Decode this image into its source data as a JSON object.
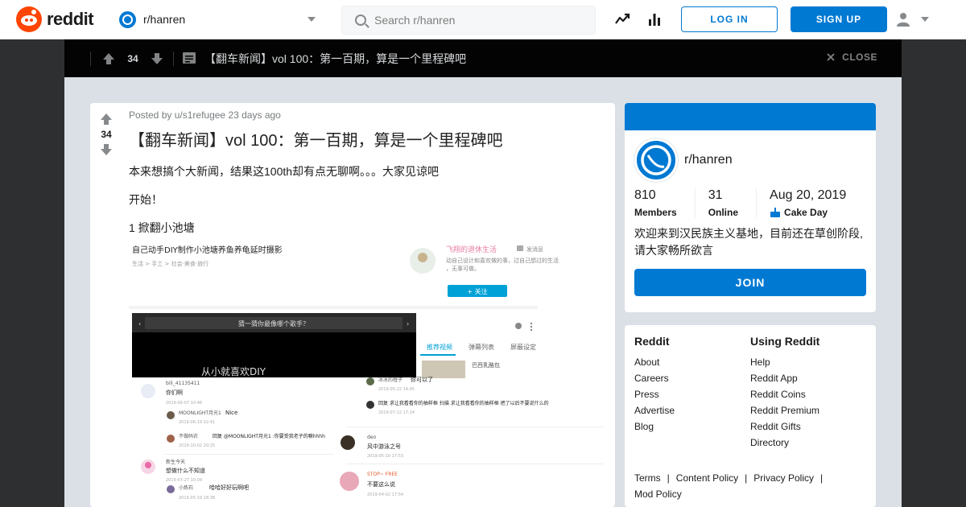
{
  "header": {
    "logo_text": "reddit",
    "community": "r/hanren",
    "search_placeholder": "Search r/hanren",
    "login_label": "LOG IN",
    "signup_label": "SIGN UP",
    "brand_color": "#ff4500",
    "accent_color": "#0079d3"
  },
  "postbar": {
    "votes": "34",
    "title": "【翻车新闻】vol 100：第一百期，算是一个里程碑吧",
    "close_label": "CLOSE"
  },
  "post": {
    "votes": "34",
    "meta_prefix": "Posted by",
    "author": "u/s1refugee",
    "age": "23 days ago",
    "title": "【翻车新闻】vol 100：第一百期，算是一个里程碑吧",
    "paragraphs": [
      "本来想搞个大新闻，结果这100th却有点无聊啊。。。大家见谅吧",
      "开始！",
      "1 掀翻小池塘"
    ],
    "image": {
      "video_title": "自己动手DIY制作小池塘养鱼养龟延时摄影",
      "breadcrumb": "生活 > 手工 > 社会·美食·旅行",
      "uploader": "飞翔的退休生活",
      "uploader_desc": "动自己设计和喜欢做的事，过自己想过的生活，无事可做。",
      "follow_label": "+ 关注",
      "player_question": "猜一猜你最像哪个歌手？",
      "player_subtitle": "从小就喜欢DIY",
      "tabs": [
        "推荐视频",
        "弹幕列表",
        "屏蔽设定"
      ],
      "rec_video": "巴西乳酪包",
      "comments_left": [
        {
          "user": "bili_41135411",
          "text": "你们啊",
          "time": "2019-06-07 10:46"
        },
        {
          "user": "MOONLIGHT月光1",
          "text": "Nice",
          "time": "2019-06-19 02:41"
        },
        {
          "user": "不做码农",
          "text": "回复 @MOONLIGHT月光1 :你要受我老子的嘛hhhh",
          "time": "2019-10-02 20:25"
        },
        {
          "user": "新生今天",
          "text": "想做什么不知道",
          "time": "2019-07-27 10:04"
        },
        {
          "user": "小炼石",
          "text": "哈哈好好玩啊吧",
          "time": "2019-05-19 18:38"
        }
      ],
      "comments_right": [
        {
          "user": "冰冰的橙子",
          "text": "你可以了",
          "time": "2019-05-22 14:45"
        },
        {
          "user": "",
          "text": "回复 求让我看看你的抽样框 扫描 求让我看看你的抽样框 把了以后不要说什么的",
          "time": "2019-07-12 17:24"
        },
        {
          "user": "deo",
          "text": "风中游泳之号",
          "time": "2019-05-10 17:53"
        },
        {
          "user": "STOP~ FREE",
          "text": "不要这么说",
          "time": "2019-04-02 17:54"
        }
      ]
    }
  },
  "sidebar": {
    "community": "r/hanren",
    "members_value": "810",
    "members_label": "Members",
    "online_value": "31",
    "online_label": "Online",
    "cake_value": "Aug 20, 2019",
    "cake_label": "Cake Day",
    "description": "欢迎来到汉民族主义基地，目前还在草创阶段,请大家畅所欲言",
    "join_label": "JOIN"
  },
  "links": {
    "col1_title": "Reddit",
    "col1": [
      "About",
      "Careers",
      "Press",
      "Advertise",
      "Blog"
    ],
    "col2_title": "Using Reddit",
    "col2": [
      "Help",
      "Reddit App",
      "Reddit Coins",
      "Reddit Premium",
      "Reddit Gifts",
      "Directory"
    ],
    "policy": [
      "Terms",
      "Content Policy",
      "Privacy Policy",
      "Mod Policy"
    ]
  }
}
